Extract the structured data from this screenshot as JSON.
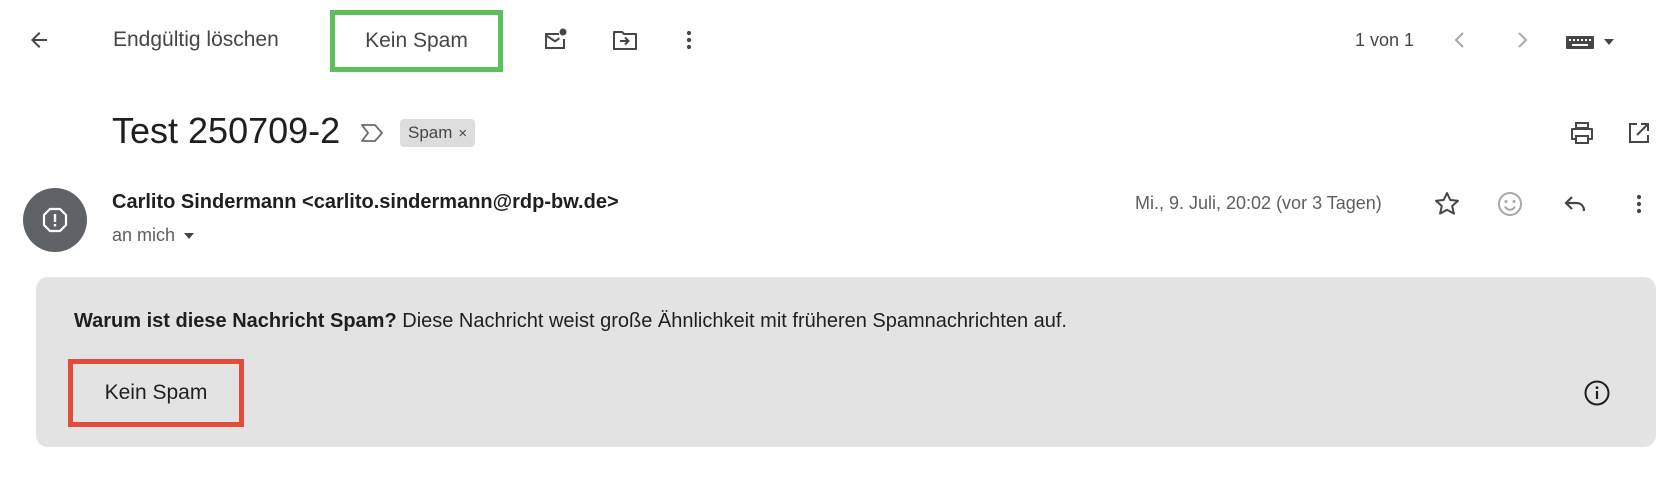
{
  "toolbar": {
    "back_icon": "arrow-left-icon",
    "delete_forever_label": "Endgültig löschen",
    "not_spam_label": "Kein Spam",
    "mark_unread_icon": "mail-unread-icon",
    "move_to_icon": "move-to-folder-icon",
    "more_icon": "more-vert-icon",
    "pagination_text": "1 von 1",
    "prev_icon": "chevron-left-icon",
    "next_icon": "chevron-right-icon",
    "input_tools_icon": "keyboard-icon"
  },
  "email": {
    "subject": "Test 250709-2",
    "importance_icon": "label-importance-icon",
    "label_chip": "Spam",
    "label_chip_remove": "×",
    "sender": "Carlito Sindermann <carlito.sindermann@rdp-bw.de>",
    "recipient_line": "an mich",
    "date": "Mi., 9. Juli, 20:02 (vor 3 Tagen)"
  },
  "spam_banner": {
    "question": "Warum ist diese Nachricht Spam?",
    "explanation": " Diese Nachricht weist große Ähnlichkeit mit früheren Spamnachrichten auf.",
    "button_label": "Kein Spam"
  },
  "colors": {
    "highlight_green": "#5cc05c",
    "highlight_red": "#e34b3b",
    "banner_bg": "#e3e3e3",
    "avatar_bg": "#5f6368"
  }
}
